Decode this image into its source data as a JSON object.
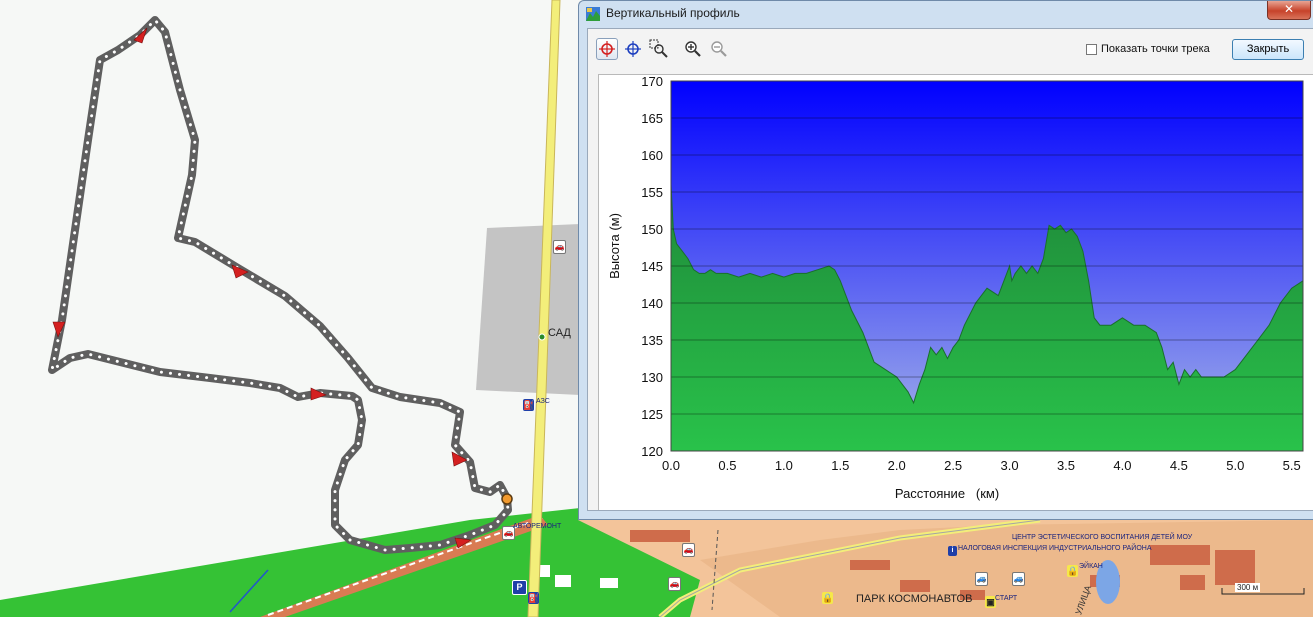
{
  "map": {
    "labels": {
      "sad": "САД",
      "azs": "АЗС",
      "avtoremont": "АВТОРЕМОНТ",
      "park": "ПАРК КОСМОНАВТОВ",
      "start": "СТАРТ",
      "center": "ЦЕНТР ЭСТЕТИЧЕСКОГО ВОСПИТАНИЯ ДЕТЕЙ МОУ",
      "tax": "НАЛОГОВАЯ ИНСПЕКЦИЯ ИНДУСТРИАЛЬНОГО РАЙОНА",
      "eikan": "ЭЙКАН",
      "street": "УЛИЦА",
      "scale": "300 м",
      "parking": "P"
    },
    "colors": {
      "track": "#5f5f5f",
      "road": "#f3ee7a",
      "green": "#35c235",
      "urban": "#f3c49a",
      "arrow": "#d42020"
    }
  },
  "window": {
    "title": "Вертикальный профиль",
    "close_x": "✕",
    "show_points_label": "Показать точки трека",
    "close_button": "Закрыть",
    "tools": [
      "select-point-icon",
      "crosshair-icon",
      "zoom-rect-icon",
      "zoom-in-icon",
      "zoom-out-icon"
    ]
  },
  "chart_data": {
    "type": "area",
    "xlabel": "Расстояние   (км)",
    "ylabel": "Высота (м)",
    "xlim": [
      0,
      5.6
    ],
    "ylim": [
      120,
      170
    ],
    "xticks": [
      "0.0",
      "0.5",
      "1.0",
      "1.5",
      "2.0",
      "2.5",
      "3.0",
      "3.5",
      "4.0",
      "4.5",
      "5.0",
      "5.5"
    ],
    "yticks": [
      "120",
      "125",
      "130",
      "135",
      "140",
      "145",
      "150",
      "155",
      "160",
      "165",
      "170"
    ],
    "grid": true,
    "colors": {
      "sky_top": "#0000ff",
      "sky_bottom": "#a7b6e8",
      "fill_top": "#1f8a3a",
      "fill_bottom": "#29c24a",
      "line": "#1a6f2c"
    },
    "x": [
      0.0,
      0.02,
      0.05,
      0.1,
      0.15,
      0.2,
      0.25,
      0.3,
      0.35,
      0.4,
      0.5,
      0.6,
      0.7,
      0.8,
      0.9,
      1.0,
      1.1,
      1.2,
      1.3,
      1.4,
      1.45,
      1.5,
      1.55,
      1.6,
      1.7,
      1.8,
      1.9,
      2.0,
      2.1,
      2.15,
      2.2,
      2.25,
      2.3,
      2.35,
      2.4,
      2.45,
      2.5,
      2.55,
      2.6,
      2.7,
      2.8,
      2.9,
      3.0,
      3.02,
      3.05,
      3.1,
      3.15,
      3.2,
      3.25,
      3.3,
      3.35,
      3.4,
      3.45,
      3.5,
      3.55,
      3.6,
      3.65,
      3.7,
      3.75,
      3.8,
      3.9,
      4.0,
      4.1,
      4.2,
      4.3,
      4.35,
      4.4,
      4.45,
      4.5,
      4.55,
      4.6,
      4.65,
      4.7,
      4.8,
      4.9,
      5.0,
      5.1,
      5.2,
      5.3,
      5.4,
      5.5,
      5.6
    ],
    "values": [
      156,
      150,
      148,
      147,
      146,
      144.5,
      144,
      144,
      144.5,
      144,
      144,
      143.5,
      144,
      143.5,
      144,
      143.5,
      144,
      144,
      144.5,
      145,
      144.5,
      143,
      141,
      139,
      136,
      132,
      131,
      130,
      128,
      126.5,
      129,
      131,
      134,
      133,
      134,
      132.5,
      134,
      135,
      137,
      140,
      142,
      141,
      145,
      143,
      144,
      145,
      144,
      145,
      144,
      146,
      150.5,
      150,
      150.5,
      149.5,
      150,
      149,
      147,
      143,
      138,
      137,
      137,
      138,
      137,
      137,
      136,
      134,
      131,
      132,
      129,
      131,
      130,
      131,
      130,
      130,
      130,
      131,
      133,
      135,
      137,
      140,
      142,
      143
    ]
  }
}
